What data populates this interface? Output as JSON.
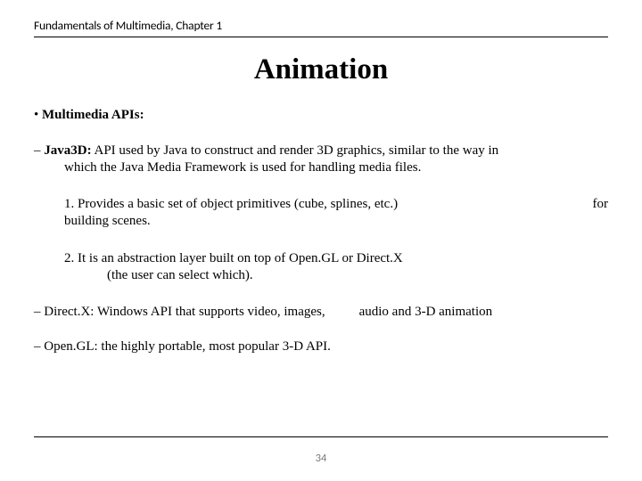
{
  "header": "Fundamentals of Multimedia, Chapter 1",
  "title": "Animation",
  "bullet1_marker": "• ",
  "bullet1_label": "Multimedia APIs:",
  "java3d": {
    "dash": "– ",
    "name": "Java3D:",
    "desc_line1": " API used by Java to construct and render 3D graphics, similar to the way in",
    "desc_line2": "which the Java Media Framework is used for handling media files."
  },
  "num1": {
    "main": "1. Provides a basic set of object primitives (cube, splines, etc.)",
    "for": "for",
    "tail": "building scenes."
  },
  "num2": {
    "line1": "2. It is an abstraction layer built on top of Open.GL or Direct.X",
    "line2": "(the user can select which)."
  },
  "directx": {
    "dash": "– ",
    "name": "Direct.X:",
    "desc": " Windows API that supports video, images,",
    "tail": "audio and 3-D animation"
  },
  "opengl": {
    "dash": "– ",
    "name": "Open.GL:",
    "desc": " the highly portable, most popular 3-D API."
  },
  "page_number": "34"
}
